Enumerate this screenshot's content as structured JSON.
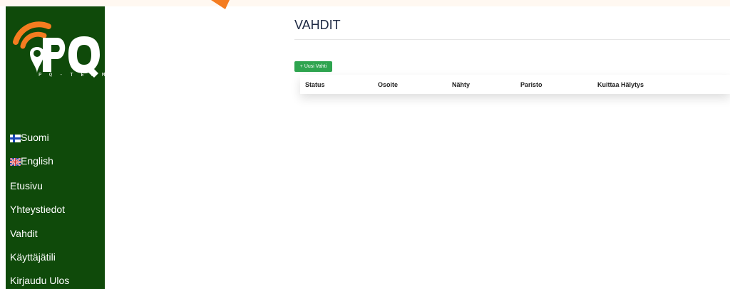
{
  "colors": {
    "sidebar_bg": "#0f4a0a",
    "logo_orange": "#f47c20",
    "button_green": "#2ea44f",
    "title_color": "#1f2a44"
  },
  "logo": {
    "text": "PQ",
    "tagline": "P Q - T E A M  O Y"
  },
  "nav": {
    "items": [
      {
        "label": "Suomi",
        "icon": "finland-flag-icon"
      },
      {
        "label": "English",
        "icon": "uk-flag-icon"
      },
      {
        "label": "Etusivu"
      },
      {
        "label": "Yhteystiedot"
      },
      {
        "label": "Vahdit"
      },
      {
        "label": "Käyttäjätili"
      },
      {
        "label": "Kirjaudu Ulos"
      }
    ]
  },
  "main": {
    "title": "VAHDIT",
    "new_button": "+ Uusi Vahti",
    "table": {
      "columns": [
        "Status",
        "Osoite",
        "Nähty",
        "Paristo",
        "Kuittaa Hälytys"
      ],
      "rows": []
    }
  }
}
